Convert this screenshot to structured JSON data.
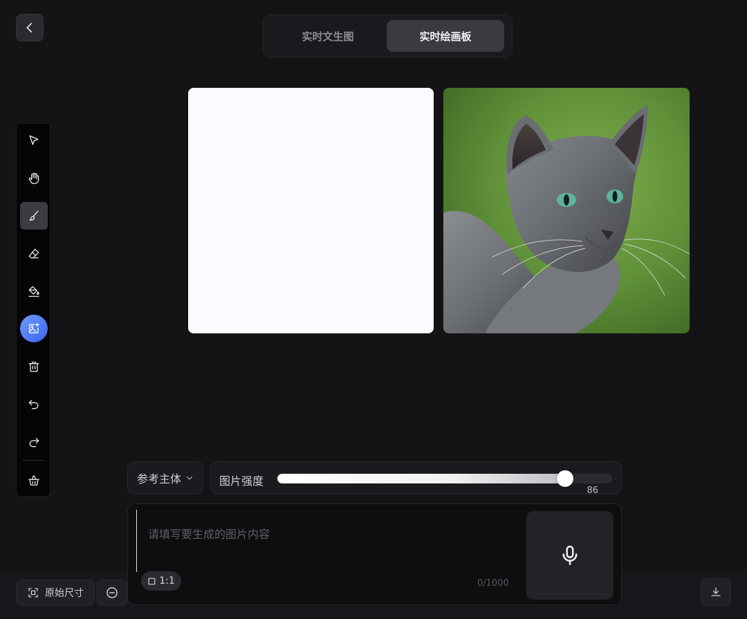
{
  "tabs": [
    {
      "label": "实时文生图",
      "active": false
    },
    {
      "label": "实时绘画板",
      "active": true
    }
  ],
  "toolbar": {
    "tools": [
      {
        "name": "select",
        "icon": "cursor-arrow-icon",
        "active": false
      },
      {
        "name": "pan",
        "icon": "hand-icon",
        "active": false
      },
      {
        "name": "brush",
        "icon": "brush-icon",
        "active": true
      },
      {
        "name": "eraser",
        "icon": "eraser-icon",
        "active": false
      },
      {
        "name": "fill",
        "icon": "paint-bucket-icon",
        "active": false
      },
      {
        "name": "upload-image",
        "icon": "image-add-icon",
        "active": false
      },
      {
        "name": "delete",
        "icon": "trash-icon",
        "active": false
      },
      {
        "name": "undo",
        "icon": "undo-icon",
        "active": false
      },
      {
        "name": "redo",
        "icon": "redo-icon",
        "active": false
      },
      {
        "name": "clear",
        "icon": "basket-icon",
        "active": false
      }
    ]
  },
  "controls": {
    "reference_label": "参考主体",
    "strength_label": "图片强度",
    "strength_value": "86",
    "strength_fraction": 0.86
  },
  "prompt": {
    "placeholder": "请填写要生成的图片内容",
    "ratio_label": "1:1",
    "char_count": "0/1000"
  },
  "bottom": {
    "original_size_label": "原始尺寸"
  },
  "colors": {
    "accent_gradient_start": "#6f9bff",
    "accent_gradient_end": "#3c63ea",
    "active_tab_bg": "#3a3a40"
  }
}
